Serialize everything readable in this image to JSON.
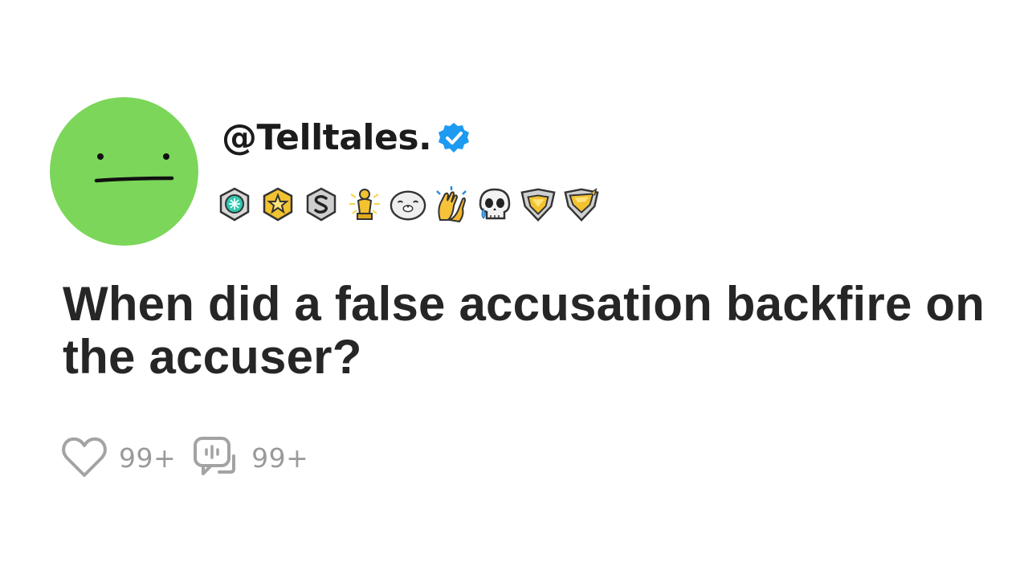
{
  "post": {
    "username": "@Telltales.",
    "verified_icon": "verified-badge-icon",
    "question": "When did a false accusation backfire on the accuser?"
  },
  "avatar": {
    "color": "#7bd65a",
    "icon": "neutral-face-icon"
  },
  "awards": [
    {
      "icon": "silver-gem-award-icon"
    },
    {
      "icon": "gold-star-award-icon"
    },
    {
      "icon": "silver-s-award-icon"
    },
    {
      "icon": "gold-trophy-award-icon"
    },
    {
      "icon": "seal-face-award-icon"
    },
    {
      "icon": "clapping-hands-award-icon"
    },
    {
      "icon": "crying-skull-award-icon"
    },
    {
      "icon": "gold-heart-shield-award-icon"
    },
    {
      "icon": "gold-wing-shield-award-icon"
    }
  ],
  "stats": {
    "likes": "99+",
    "comments": "99+",
    "like_icon": "heart-icon",
    "comment_icon": "comment-icon"
  },
  "colors": {
    "verified": "#1d9bf0",
    "text": "#262626",
    "muted": "#9a9a9a",
    "gold": "#f2c230"
  }
}
